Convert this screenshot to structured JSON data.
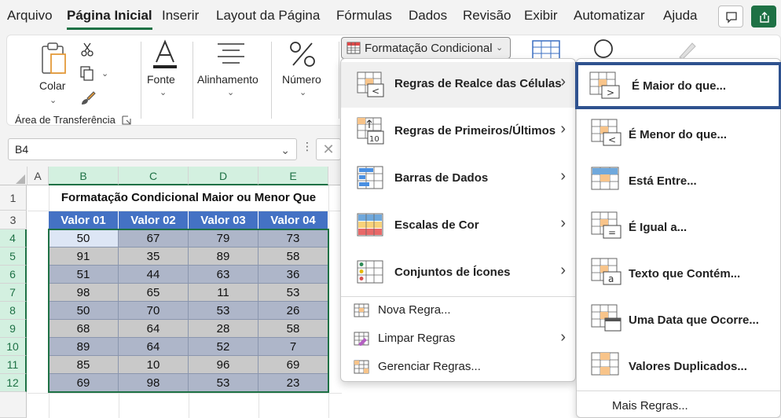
{
  "ribbon_tabs": [
    "Arquivo",
    "Página Inicial",
    "Inserir",
    "Layout da Página",
    "Fórmulas",
    "Dados",
    "Revisão",
    "Exibir",
    "Automatizar",
    "Ajuda"
  ],
  "ribbon": {
    "colar": "Colar",
    "clipboard_group": "Área de Transferência",
    "fonte": "Fonte",
    "alinhamento": "Alinhamento",
    "numero": "Número",
    "cond_format_button": "Formatação Condicional"
  },
  "formula_bar": {
    "name_box": "B4"
  },
  "sheet": {
    "columns": [
      "A",
      "B",
      "C",
      "D",
      "E"
    ],
    "rows": [
      "1",
      "3",
      "4",
      "5",
      "6",
      "7",
      "8",
      "9",
      "10",
      "11",
      "12"
    ],
    "title": "Formatação Condicional Maior ou Menor Que",
    "headers": [
      "Valor 01",
      "Valor 02",
      "Valor 03",
      "Valor 04"
    ],
    "data": [
      [
        "50",
        "67",
        "79",
        "73"
      ],
      [
        "91",
        "35",
        "89",
        "58"
      ],
      [
        "51",
        "44",
        "63",
        "36"
      ],
      [
        "98",
        "65",
        "11",
        "53"
      ],
      [
        "50",
        "70",
        "53",
        "26"
      ],
      [
        "68",
        "64",
        "28",
        "58"
      ],
      [
        "89",
        "64",
        "52",
        "7"
      ],
      [
        "85",
        "10",
        "96",
        "69"
      ],
      [
        "69",
        "98",
        "53",
        "23"
      ]
    ]
  },
  "menu": {
    "items": [
      "Regras de Realce das Células",
      "Regras de Primeiros/Últimos",
      "Barras de Dados",
      "Escalas de Cor",
      "Conjuntos de Ícones"
    ],
    "small_items": [
      "Nova Regra...",
      "Limpar Regras",
      "Gerenciar Regras..."
    ]
  },
  "submenu": {
    "items": [
      "É Maior do que...",
      "É Menor do que...",
      "Está Entre...",
      "É Igual a...",
      "Texto que Contém...",
      "Uma Data que Ocorre...",
      "Valores Duplicados..."
    ],
    "more": "Mais Regras..."
  },
  "colors": {
    "accent_green": "#1e7145",
    "header_blue": "#4472c4",
    "band_dark": "#aeb6c9",
    "band_light": "#c9c9c9",
    "focus_border": "#2f528f"
  }
}
